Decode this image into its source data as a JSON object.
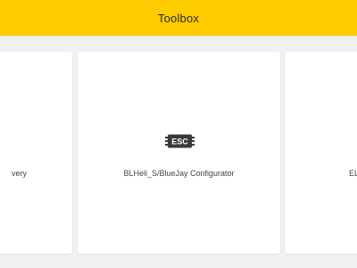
{
  "header": {
    "title": "Toolbox",
    "color": "#ffcc00"
  },
  "cards": [
    {
      "label": "very",
      "icon": null
    },
    {
      "label": "BLHeli_S/BlueJay Configurator",
      "icon": "esc-chip-icon",
      "icon_text": "ESC"
    },
    {
      "label": "EL",
      "icon": null
    }
  ]
}
